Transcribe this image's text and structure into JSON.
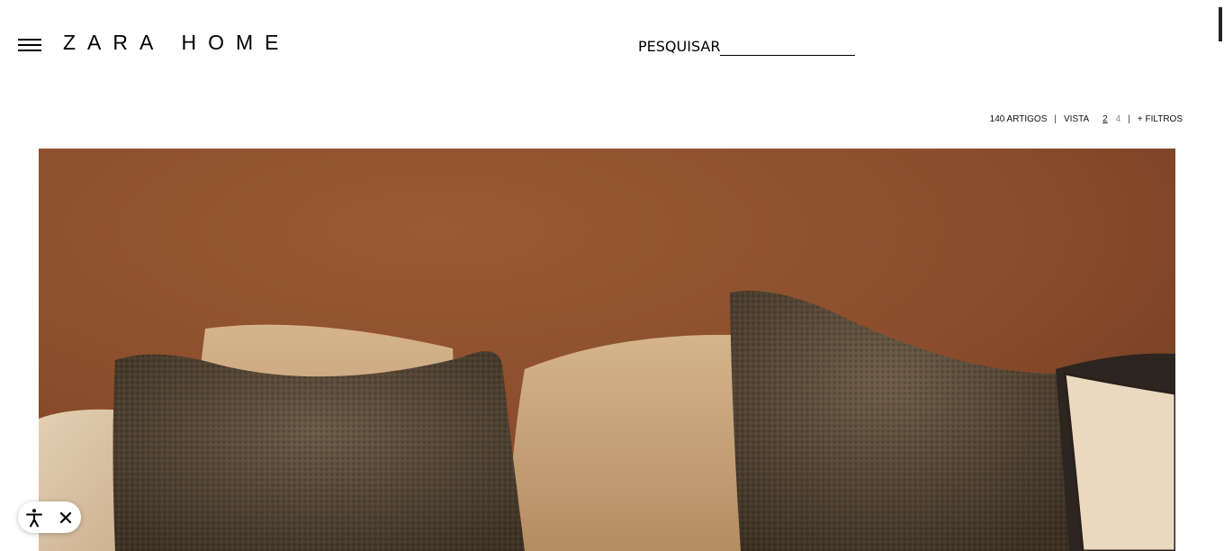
{
  "header": {
    "logo_text": "ZARA HOME",
    "search_label": "PESQUISAR",
    "menu_icon": "hamburger-icon"
  },
  "toolbar": {
    "item_count": "140 ARTIGOS",
    "separator": "|",
    "view_label": "VISTA",
    "view_options": [
      "2",
      "4"
    ],
    "active_view": "2",
    "filters_label": "+ FILTROS"
  },
  "hero": {
    "image_subject": "cushions-on-sofa",
    "wall_color": "#8d4f2e",
    "cushion_color": "#5d4e3c",
    "linen_color": "#c9a47c"
  },
  "accessibility_widget": {
    "icon": "accessibility-icon",
    "close_icon": "close-icon"
  }
}
